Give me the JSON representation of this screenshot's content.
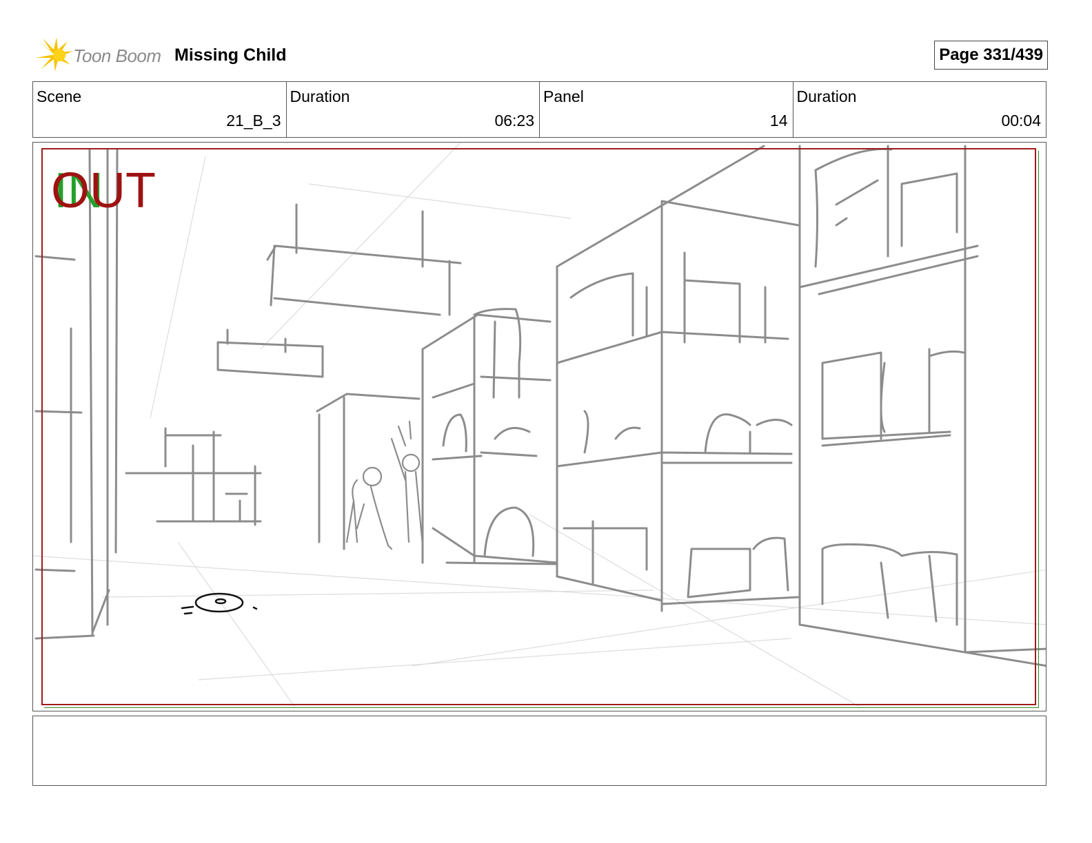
{
  "header": {
    "logo_text": "Toon Boom",
    "project_title": "Missing Child",
    "page_label": "Page 331/439"
  },
  "info": {
    "scene_label": "Scene",
    "scene_value": "21_B_3",
    "scene_duration_label": "Duration",
    "scene_duration_value": "06:23",
    "panel_label": "Panel",
    "panel_value": "14",
    "panel_duration_label": "Duration",
    "panel_duration_value": "00:04"
  },
  "panel": {
    "in_marker": "IN",
    "out_marker": "OUT",
    "colors": {
      "sketch": "#8c8c8c",
      "frame_red": "#9e1b1b",
      "frame_green": "#2a8a2a",
      "in": "#22a12a",
      "out": "#9e1212"
    }
  },
  "notes": {
    "text": ""
  }
}
